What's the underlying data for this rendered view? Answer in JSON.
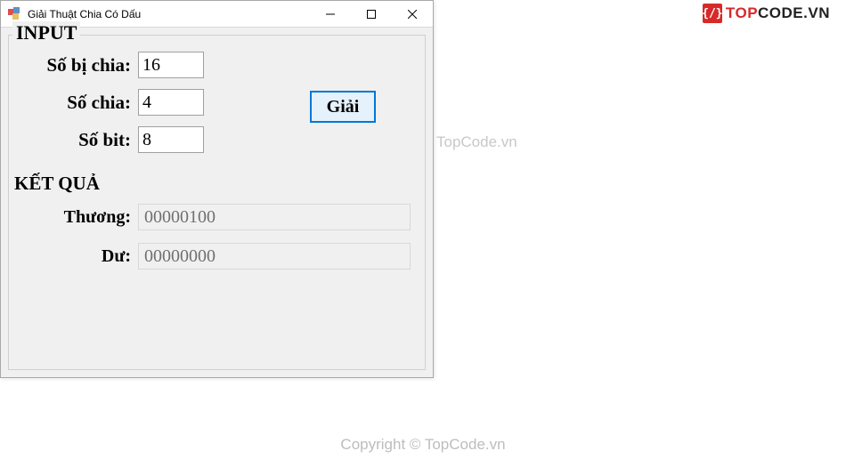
{
  "window": {
    "title": "Giải Thuật Chia Có Dấu"
  },
  "input": {
    "group_label": "INPUT",
    "dividend_label": "Số bị chia:",
    "dividend_value": "16",
    "divisor_label": "Số chia:",
    "divisor_value": "4",
    "bits_label": "Số bit:",
    "bits_value": "8",
    "solve_button": "Giải"
  },
  "result": {
    "header": "KẾT QUẢ",
    "quotient_label": "Thương:",
    "quotient_value": "00000100",
    "remainder_label": "Dư:",
    "remainder_value": "00000000"
  },
  "branding": {
    "logo_top": "TOP",
    "logo_code": "CODE.VN",
    "watermark_center": "TopCode.vn",
    "watermark_bottom": "Copyright © TopCode.vn"
  }
}
